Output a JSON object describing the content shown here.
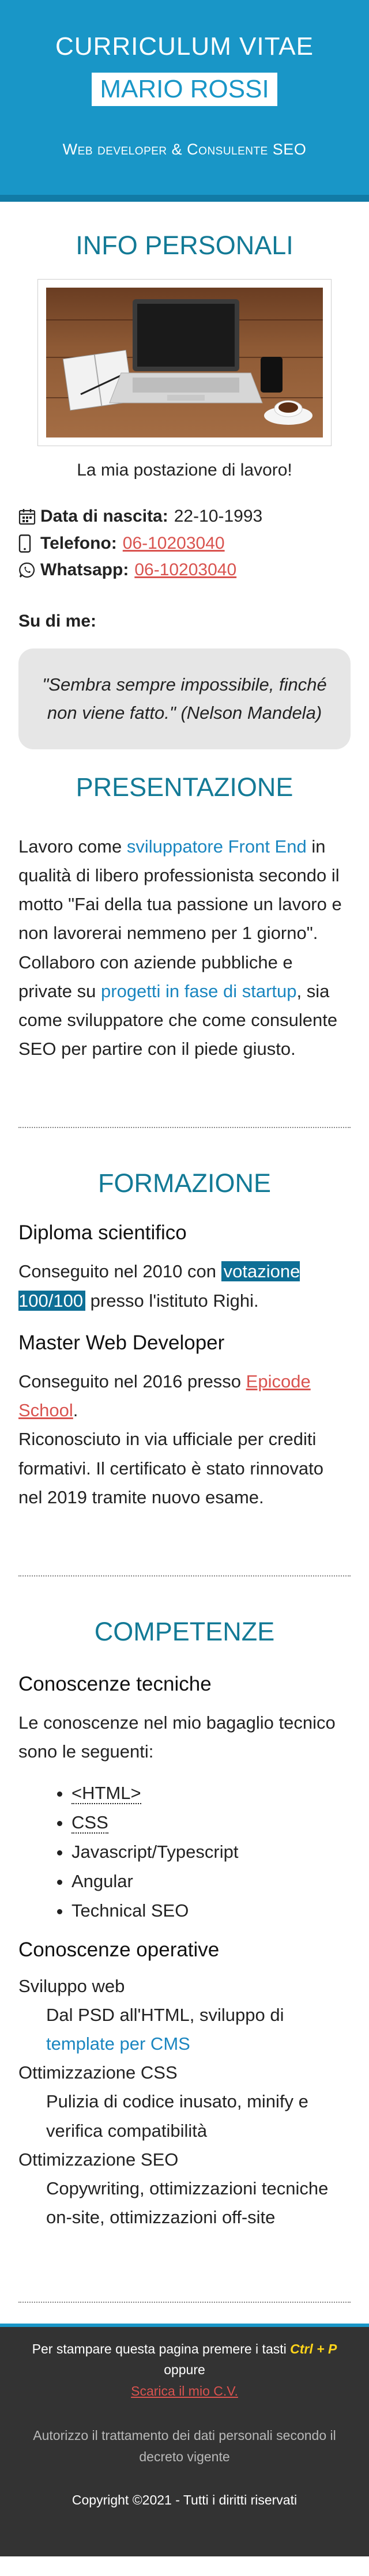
{
  "header": {
    "title": "CURRICULUM VITAE",
    "name": "MARIO ROSSI",
    "role": "Web developer & Consulente SEO"
  },
  "info": {
    "title": "INFO PERSONALI",
    "photo_caption": "La mia postazione di lavoro!",
    "birth_label": "Data di nascita:",
    "birth_value": "22-10-1993",
    "phone_label": "Telefono:",
    "phone_value": "06-10203040",
    "whatsapp_label": "Whatsapp:",
    "whatsapp_value": "06-10203040",
    "about_label": "Su di me:",
    "quote": "\"Sembra sempre impossibile, finché non viene fatto.\" (Nelson Mandela)"
  },
  "presentazione": {
    "title": "PRESENTAZIONE",
    "p1": "Lavoro come ",
    "link1": "sviluppatore Front End",
    "p2": " in qualità di libero professionista secondo il motto \"Fai della tua passione un lavoro e non lavorerai nemmeno per 1 giorno\". Collaboro con aziende pubbliche e private su ",
    "link2": "progetti in fase di startup",
    "p3": ", sia come sviluppatore che come consulente SEO per partire con il piede giusto."
  },
  "formazione": {
    "title": "FORMAZIONE",
    "sub1": "Diploma scientifico",
    "d1_a": "Conseguito nel 2010 con ",
    "d1_hl": "votazione 100/100",
    "d1_b": " presso l'istituto Righi.",
    "sub2": "Master Web Developer",
    "d2_a": "Conseguito nel 2016 presso ",
    "d2_link": "Epicode School",
    "d2_b": ".",
    "d2_c": "Riconosciuto in via ufficiale per crediti formativi. Il certificato è stato rinnovato nel 2019 tramite nuovo esame."
  },
  "competenze": {
    "title": "COMPETENZE",
    "sub1": "Conoscenze tecniche",
    "intro": "Le conoscenze nel mio bagaglio tecnico sono le seguenti:",
    "skills": [
      "<HTML>",
      "CSS",
      "Javascript/Typescript",
      "Angular",
      "Technical SEO"
    ],
    "sub2": "Conoscenze operative",
    "ops": [
      {
        "term": "Sviluppo web",
        "desc_a": "Dal PSD all'HTML, sviluppo di ",
        "desc_link": "template per CMS"
      },
      {
        "term": "Ottimizzazione CSS",
        "desc": "Pulizia di codice inusato, minify e verifica compatibilità"
      },
      {
        "term": "Ottimizzazione SEO",
        "desc": "Copywriting, ottimizzazioni tecniche on-site, ottimizzazioni off-site"
      }
    ]
  },
  "footer": {
    "print_a": "Per stampare questa pagina premere i tasti ",
    "print_key": "Ctrl + P",
    "print_b": " oppure",
    "download": "Scarica il mio C.V.",
    "legal": "Autorizzo il trattamento dei dati personali secondo il decreto vigente",
    "copyright": "Copyright ©2021 - Tutti i diritti riservati"
  },
  "colors": {
    "accent": "#1996c7",
    "title": "#137a96",
    "link": "#1a86c0",
    "link_alt": "#d9534f",
    "footer_bg": "#333333",
    "footer_key": "#ffd41a"
  }
}
